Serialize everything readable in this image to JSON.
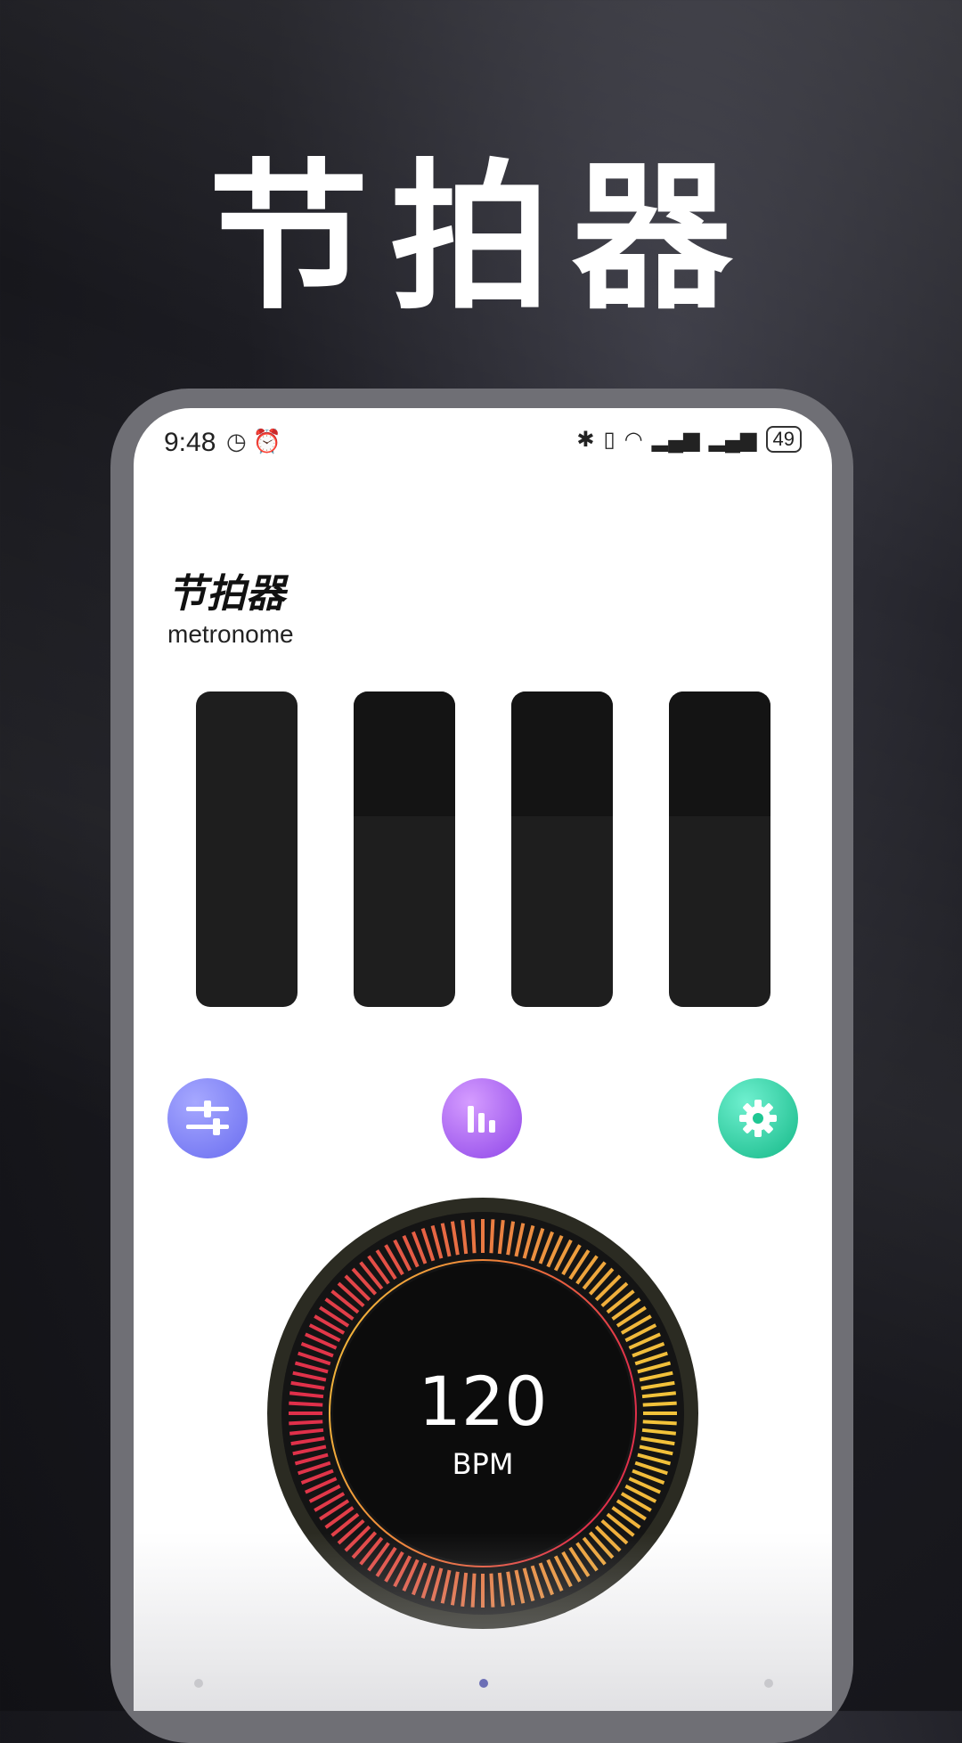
{
  "promo": {
    "title": "节拍器"
  },
  "status_bar": {
    "time": "9:48",
    "left_icons": [
      "clock-badge-icon",
      "alarm-icon"
    ],
    "right_icons": [
      "bluetooth-icon",
      "vibrate-icon",
      "wifi-icon",
      "signal-4g-icon",
      "signal-5g-icon"
    ],
    "battery": "49"
  },
  "app": {
    "title": "节拍器",
    "subtitle": "metronome"
  },
  "beats": [
    {
      "active_level": 0
    },
    {
      "active_level": 0.6
    },
    {
      "active_level": 0.6
    },
    {
      "active_level": 0.6
    }
  ],
  "controls": [
    {
      "name": "mixer",
      "icon": "sliders-icon"
    },
    {
      "name": "stats",
      "icon": "bar-chart-icon"
    },
    {
      "name": "settings",
      "icon": "gear-icon"
    }
  ],
  "tempo": {
    "value": "120",
    "unit": "BPM"
  },
  "colors": {
    "dial_start": "#f2c23a",
    "dial_end": "#e0304a",
    "beat_block": "#1e1e1e"
  },
  "pager": {
    "count": 3,
    "active_index": 1
  }
}
